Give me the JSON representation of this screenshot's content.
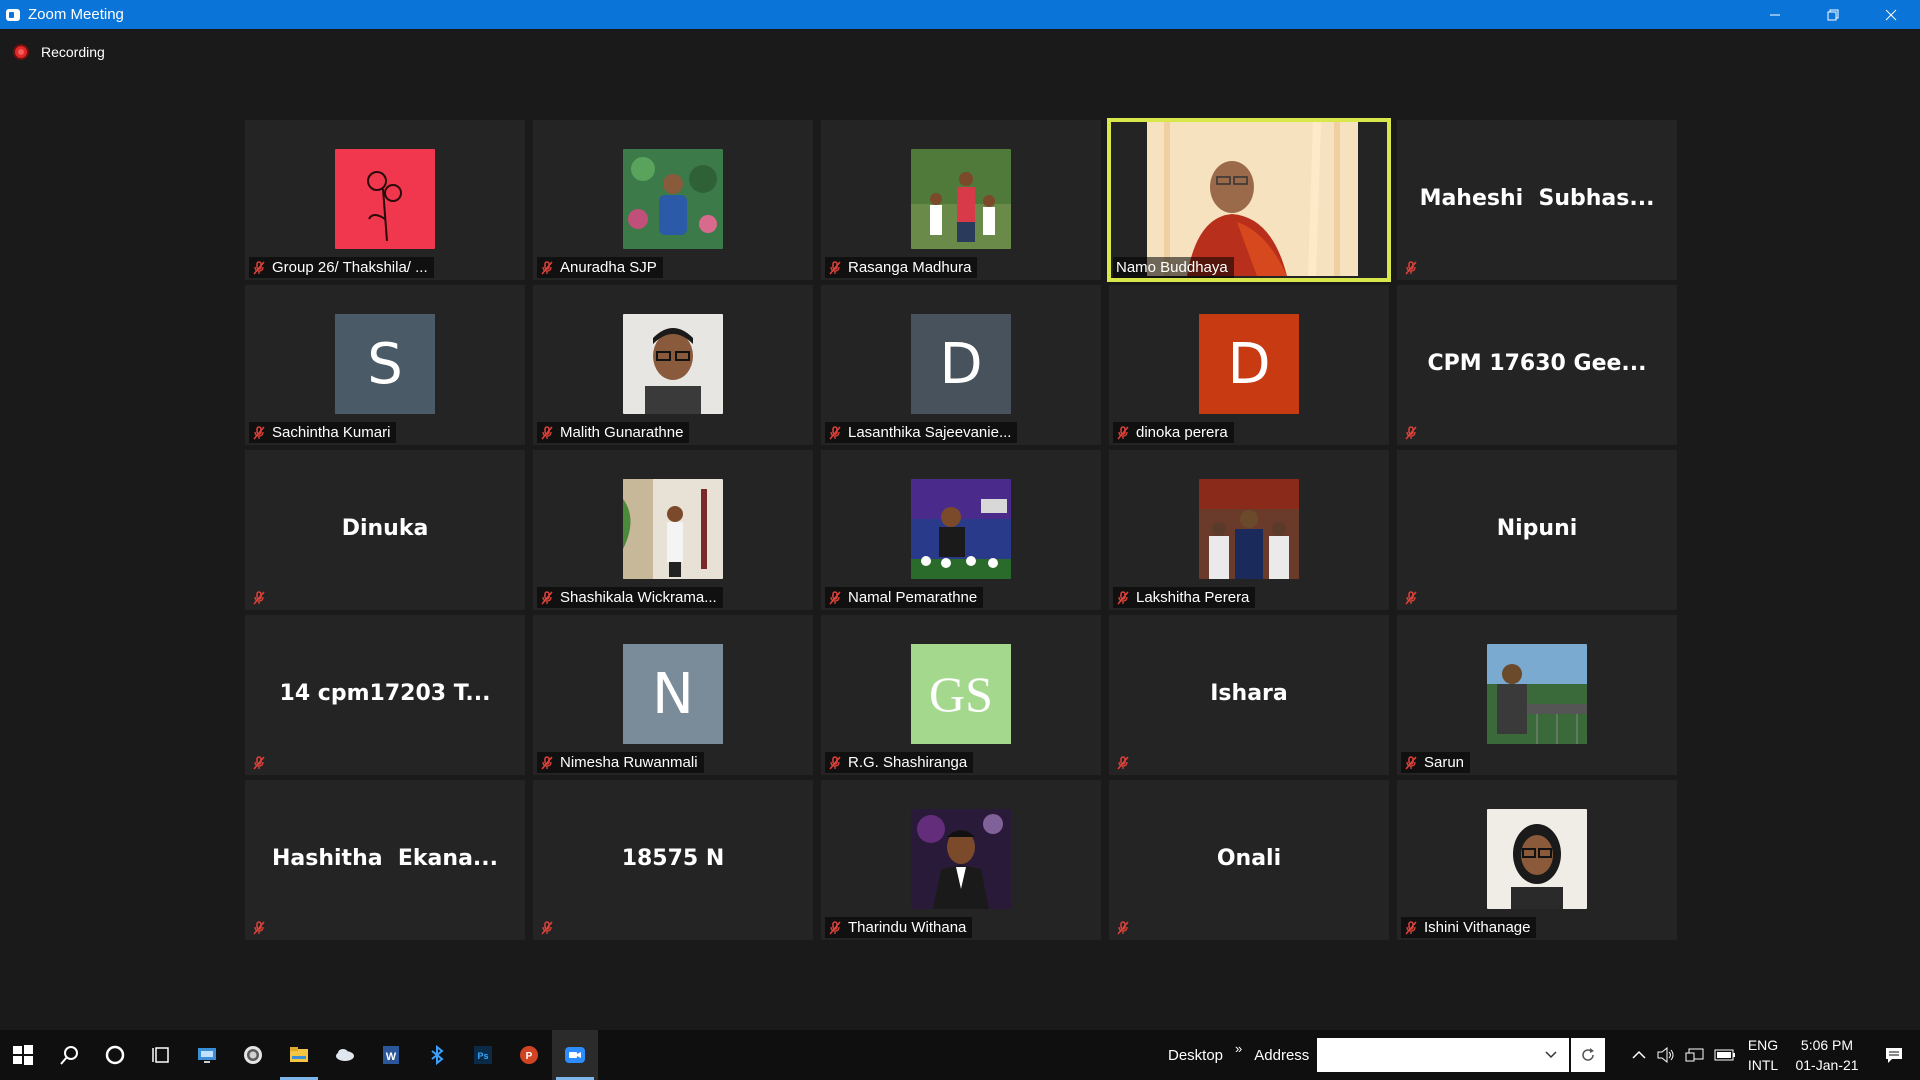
{
  "window": {
    "title": "Zoom Meeting",
    "controls": [
      "minimize-icon",
      "restore-icon",
      "close-icon"
    ]
  },
  "recording": {
    "label": "Recording"
  },
  "participants": [
    {
      "name": "Group 26/ Thakshila/ ...",
      "display": "photo",
      "photo": "roses",
      "muted": true
    },
    {
      "name": "Anuradha SJP",
      "display": "photo",
      "photo": "garden-man",
      "muted": true
    },
    {
      "name": "Rasanga Madhura",
      "display": "photo",
      "photo": "family",
      "muted": true
    },
    {
      "name": "Namo Buddhaya",
      "display": "video",
      "muted": false,
      "active": true
    },
    {
      "name": "",
      "display": "name",
      "big_label": "Maheshi  Subhas...",
      "muted": true
    },
    {
      "name": "Sachintha Kumari",
      "display": "letter",
      "letter": "S",
      "color": "#4a5a66",
      "muted": true
    },
    {
      "name": "Malith Gunarathne",
      "display": "photo",
      "photo": "portrait-glasses",
      "muted": true
    },
    {
      "name": "Lasanthika Sajeevanie...",
      "display": "letter",
      "letter": "D",
      "color": "#47525c",
      "muted": true
    },
    {
      "name": "dinoka perera",
      "display": "letter",
      "letter": "D",
      "color": "#c83a12",
      "muted": true
    },
    {
      "name": "",
      "display": "name",
      "big_label": "CPM 17630 Gee...",
      "muted": true
    },
    {
      "name": "",
      "display": "name",
      "big_label": "Dinuka",
      "muted": true
    },
    {
      "name": "Shashikala Wickrama...",
      "display": "photo",
      "photo": "woman-room",
      "muted": true
    },
    {
      "name": "Namal Pemarathne",
      "display": "photo",
      "photo": "speaker-stage",
      "muted": true
    },
    {
      "name": "Lakshitha Perera",
      "display": "photo",
      "photo": "group-blue",
      "muted": true
    },
    {
      "name": "",
      "display": "name",
      "big_label": "Nipuni",
      "muted": true
    },
    {
      "name": "",
      "display": "name",
      "big_label": "14 cpm17203 T...",
      "muted": true
    },
    {
      "name": "Nimesha Ruwanmali",
      "display": "letter",
      "letter": "N",
      "color": "#7a8b99",
      "muted": true
    },
    {
      "name": "R.G. Shashiranga",
      "display": "letter",
      "letter": "GS",
      "color": "#a4d88c",
      "muted": true
    },
    {
      "name": "",
      "display": "name",
      "big_label": "Ishara",
      "muted": true
    },
    {
      "name": "Sarun",
      "display": "photo",
      "photo": "man-outdoor",
      "muted": true
    },
    {
      "name": "",
      "display": "name",
      "big_label": "Hashitha  Ekana...",
      "muted": true
    },
    {
      "name": "",
      "display": "name",
      "big_label": "18575 N",
      "muted": true
    },
    {
      "name": "Tharindu Withana",
      "display": "photo",
      "photo": "man-suit",
      "muted": true
    },
    {
      "name": "",
      "display": "name",
      "big_label": "Onali",
      "muted": true
    },
    {
      "name": "Ishini Vithanage",
      "display": "photo",
      "photo": "woman-glasses",
      "muted": true
    }
  ],
  "taskbar": {
    "apps": [
      "start-icon",
      "search-icon",
      "cortana-icon",
      "task-view-icon",
      "computer-icon",
      "chrome-icon",
      "file-explorer-icon",
      "cloud-icon",
      "word-icon",
      "bluetooth-icon",
      "photoshop-icon",
      "powerpoint-icon",
      "zoom-icon"
    ],
    "desktop_label": "Desktop",
    "chevron": "»",
    "address_label": "Address",
    "lang_top": "ENG",
    "lang_bottom": "INTL",
    "time": "5:06 PM",
    "date": "01-Jan-21"
  },
  "colors": {
    "titlebar": "#0b74d8",
    "active_speaker": "#d8e84a",
    "mic_muted": "#e0423a",
    "background": "#1a1a1a",
    "tile": "#242424"
  }
}
